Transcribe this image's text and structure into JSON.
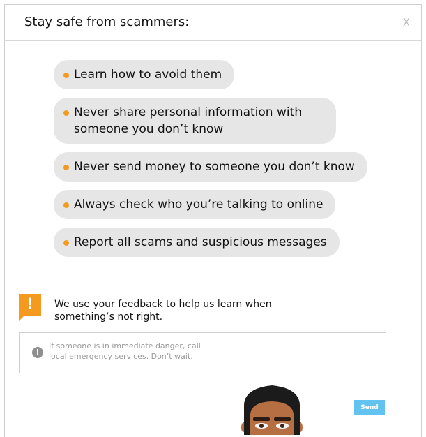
{
  "header": {
    "title": "Stay safe from scammers:",
    "close_label": "X"
  },
  "tips": [
    "Learn how to avoid them",
    "Never share personal information with someone you don’t know",
    "Never send money to someone you don’t know",
    "Always check who you’re talking to online",
    "Report all scams and suspicious messages"
  ],
  "feedback": {
    "icon_label": "!",
    "text": "We use your feedback to help us learn when something’s not right."
  },
  "info": {
    "icon_label": "!",
    "text": "If someone is in immediate danger, call local emergency services. Don’t wait."
  },
  "send_label": "Send",
  "colors": {
    "accent_orange": "#f39a1f",
    "send_blue": "#63c3f0",
    "bubble_gray": "#e6e6e6"
  },
  "icons": {
    "close": "close-icon",
    "alert": "exclamation-icon",
    "info": "info-icon",
    "avatar": "avatar-illustration"
  }
}
